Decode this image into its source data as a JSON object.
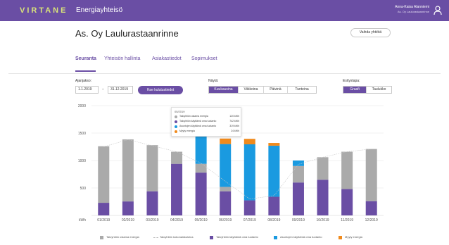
{
  "header": {
    "logo": "VIRTANE",
    "app_name": "Energiayhteisö",
    "user_name": "Anna-Kaisa Alanniemi",
    "user_org": "As. Oy Laulurastaanrinne",
    "bg_color": "#6a4ea4",
    "logo_color": "#d8e27a",
    "user_icon": "user-icon"
  },
  "page": {
    "title": "As. Oy Laulurastaanrinne",
    "change_button": "Vaihda yhtiötä"
  },
  "tabs": [
    {
      "label": "Seuranta",
      "active": true
    },
    {
      "label": "Yhteisön hallinta",
      "active": false
    },
    {
      "label": "Asiakastiedot",
      "active": false
    },
    {
      "label": "Sopimukset",
      "active": false
    }
  ],
  "filters": {
    "period_label": "Ajanjakso:",
    "start_date": "1.1.2019",
    "separator": "–",
    "end_date": "31.12.2019",
    "fetch_button": "Hae kulutustiedot",
    "show_label": "Näytä:",
    "show_options": [
      "Kuukausina",
      "Viikkoina",
      "Päivinä",
      "Tunteina"
    ],
    "show_selected": 0,
    "view_label": "Esitystapa:",
    "view_options": [
      "Graafi",
      "Taulukko"
    ],
    "view_selected": 0
  },
  "tooltip": {
    "title": "05/2019",
    "rows": [
      {
        "label": "Taloyhtiön ostama energia",
        "value": "120 kWh",
        "color": "#aaaaaa"
      },
      {
        "label": "Taloyhtiön käyttämä oma tuotanto",
        "value": "742 kWh",
        "color": "#6a4ea4"
      },
      {
        "label": "Asuntojen käyttämä oma tuotanto",
        "value": "319 kWh",
        "color": "#1a9ae0"
      },
      {
        "label": "Myyty energia",
        "value": "24 kWh",
        "color": "#f08a1c"
      }
    ]
  },
  "chart_data": {
    "type": "bar",
    "stacked": true,
    "y_unit_label": "kWh",
    "ylim": [
      0,
      2000
    ],
    "y_ticks": [
      500,
      1000,
      1500,
      2000
    ],
    "grid": "horizontal",
    "legend_position": "bottom",
    "categories": [
      "01/2019",
      "02/2019",
      "03/2019",
      "04/2019",
      "05/2019",
      "06/2019",
      "07/2019",
      "08/2019",
      "09/2019",
      "10/2019",
      "11/2019",
      "12/2019"
    ],
    "series": [
      {
        "name": "Taloyhtiön käyttämä oma tuotanto",
        "color": "#6a4ea4",
        "values": [
          230,
          255,
          440,
          940,
          780,
          440,
          275,
          340,
          600,
          650,
          480,
          260
        ]
      },
      {
        "name": "Taloyhtiön ostama energia",
        "color": "#aaaaaa",
        "values": [
          1030,
          1130,
          840,
          220,
          160,
          80,
          0,
          0,
          300,
          410,
          680,
          950
        ]
      },
      {
        "name": "Asuntojen käyttämä oma tuotanto",
        "color": "#1a9ae0",
        "values": [
          0,
          0,
          0,
          0,
          550,
          780,
          1020,
          930,
          100,
          0,
          0,
          0
        ]
      },
      {
        "name": "Myyty energia",
        "color": "#f08a1c",
        "values": [
          0,
          0,
          0,
          0,
          40,
          100,
          100,
          50,
          0,
          0,
          0,
          0
        ]
      }
    ],
    "line_series": {
      "name": "Taloyhtiön kokonaiskulutus",
      "color": "#c8c8c8",
      "values": [
        1250,
        1380,
        1270,
        1160,
        950,
        620,
        300,
        360,
        930,
        1060,
        1160,
        1210
      ]
    },
    "legend": [
      {
        "label": "Taloyhtiön ostama energia",
        "color": "#aaaaaa",
        "kind": "bar"
      },
      {
        "label": "Taloyhtiön kokonaiskulutus",
        "color": "#c8c8c8",
        "kind": "line"
      },
      {
        "label": "Taloyhtiön käyttämä oma tuotanto",
        "color": "#6a4ea4",
        "kind": "bar"
      },
      {
        "label": "Asuntojen käyttämä oma tuotanto",
        "color": "#1a9ae0",
        "kind": "bar"
      },
      {
        "label": "Myyty energia",
        "color": "#f08a1c",
        "kind": "bar"
      }
    ]
  }
}
